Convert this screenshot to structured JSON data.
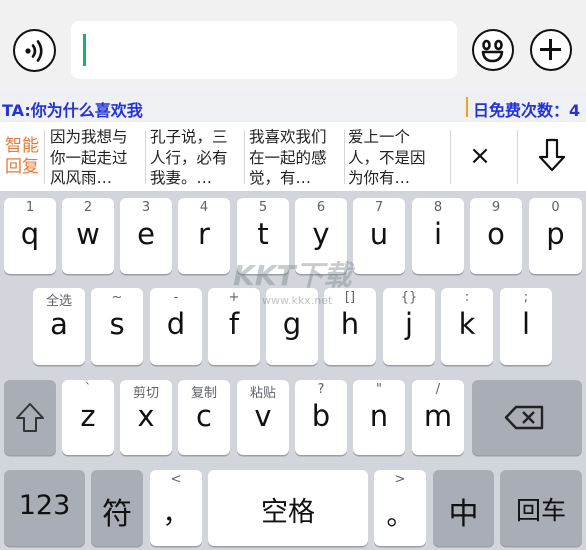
{
  "top_bar": {
    "input_value": "",
    "voice_icon": "voice-wave-icon",
    "emoji_icon": "smiley-face-icon",
    "plus_icon": "plus-icon"
  },
  "info_bar": {
    "chat_label": "TA:你为什么喜欢我",
    "free_count_label": "日免费次数：4"
  },
  "suggestions": {
    "smart_reply_label": "智能回复",
    "items": [
      "因为我想与你一起走过风风雨…",
      "孔子说，三人行，必有我妻。…",
      "我喜欢我们在一起的感觉，有…",
      "爱上一个人，不是因为你有…"
    ],
    "close_label": "×",
    "down_icon": "arrow-down-icon"
  },
  "keyboard": {
    "row1": [
      {
        "sub": "1",
        "main": "q"
      },
      {
        "sub": "2",
        "main": "w"
      },
      {
        "sub": "3",
        "main": "e"
      },
      {
        "sub": "4",
        "main": "r"
      },
      {
        "sub": "5",
        "main": "t"
      },
      {
        "sub": "6",
        "main": "y"
      },
      {
        "sub": "7",
        "main": "u"
      },
      {
        "sub": "8",
        "main": "i"
      },
      {
        "sub": "9",
        "main": "o"
      },
      {
        "sub": "0",
        "main": "p"
      }
    ],
    "row2": [
      {
        "sub": "全选",
        "main": "a"
      },
      {
        "sub": "~",
        "main": "s"
      },
      {
        "sub": "-",
        "main": "d"
      },
      {
        "sub": "+",
        "main": "f"
      },
      {
        "sub": "",
        "main": "g"
      },
      {
        "sub": "[]",
        "main": "h"
      },
      {
        "sub": "{}",
        "main": "j"
      },
      {
        "sub": ":",
        "main": "k"
      },
      {
        "sub": ";",
        "main": "l"
      }
    ],
    "row3": [
      {
        "sub": "`",
        "main": "z"
      },
      {
        "sub": "剪切",
        "main": "x"
      },
      {
        "sub": "复制",
        "main": "c"
      },
      {
        "sub": "粘贴",
        "main": "v"
      },
      {
        "sub": "?",
        "main": "b"
      },
      {
        "sub": "\"",
        "main": "n"
      },
      {
        "sub": "/",
        "main": "m"
      }
    ],
    "shift_icon": "shift-arrow-icon",
    "backspace_icon": "backspace-icon",
    "bottom": {
      "num_label": "123",
      "symbol_label": "符",
      "comma_sub": "<",
      "comma_label": "，",
      "space_label": "空格",
      "period_sub": ">",
      "period_label": "。",
      "lang_label": "中",
      "enter_label": "回车"
    }
  },
  "watermark": {
    "text": "KKT下载",
    "url": "www.kkx.net"
  }
}
